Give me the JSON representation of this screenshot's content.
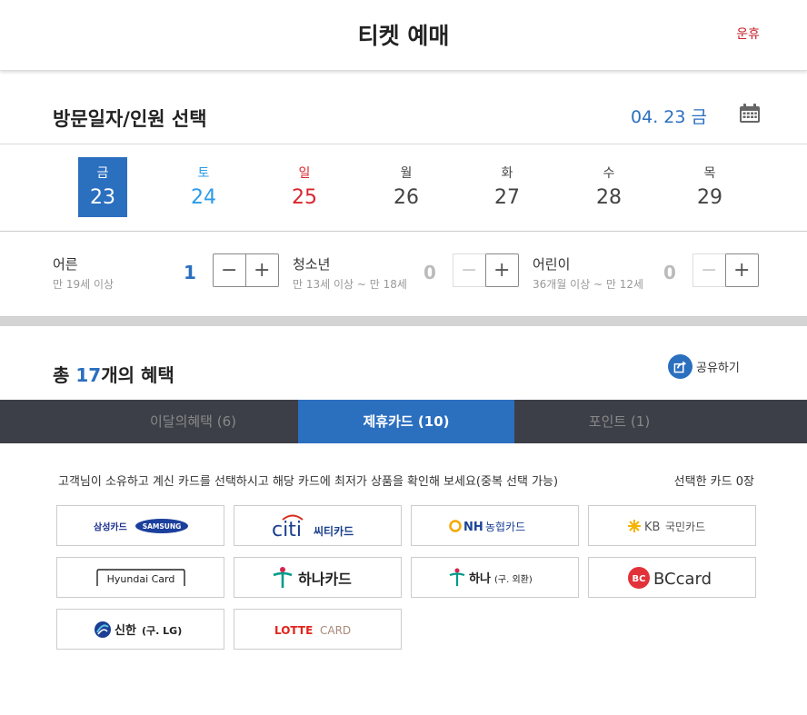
{
  "header": {
    "title": "티켓 예매",
    "closed_label": "운휴"
  },
  "date_section": {
    "label": "방문일자/인원 선택",
    "selected_date": "04. 23 금",
    "calendar_icon": "calendar-icon"
  },
  "days": [
    {
      "dow": "금",
      "num": "23",
      "state": "active"
    },
    {
      "dow": "토",
      "num": "24",
      "state": "sat"
    },
    {
      "dow": "일",
      "num": "25",
      "state": "sun"
    },
    {
      "dow": "월",
      "num": "26",
      "state": "normal"
    },
    {
      "dow": "화",
      "num": "27",
      "state": "normal"
    },
    {
      "dow": "수",
      "num": "28",
      "state": "normal"
    },
    {
      "dow": "목",
      "num": "29",
      "state": "normal"
    }
  ],
  "people": {
    "adult": {
      "name": "어른",
      "desc": "만 19세 이상",
      "count": "1"
    },
    "youth": {
      "name": "청소년",
      "desc": "만 13세 이상 ~ 만 18세",
      "count": "0"
    },
    "child": {
      "name": "어린이",
      "desc": "36개월 이상 ~ 만 12세",
      "count": "0"
    },
    "minus": "−",
    "plus": "+"
  },
  "benefits": {
    "prefix": "총 ",
    "count": "17",
    "suffix": "개의 혜택",
    "share_label": "공유하기"
  },
  "tabs": [
    {
      "label": "이달의혜택 (6)",
      "active": false
    },
    {
      "label": "제휴카드 (10)",
      "active": true
    },
    {
      "label": "포인트 (1)",
      "active": false
    }
  ],
  "cards_section": {
    "intro": "고객님이 소유하고 계신 카드를 선택하시고 해당 카드에 최저가 상품을 확인해 보세요(중복 선택 가능)",
    "selected_prefix": "선택한 카드 ",
    "selected_count": "0",
    "selected_suffix": "장"
  },
  "cards": {
    "samsung": {
      "kr": "삼성카드",
      "en": "SAMSUNG"
    },
    "citi": {
      "en": "citi",
      "kr": "씨티카드"
    },
    "nh": {
      "en": "NH",
      "kr": "농협카드"
    },
    "kb": {
      "en": "KB",
      "kr": "국민카드"
    },
    "hyundai": {
      "en": "Hyundai Card"
    },
    "hana": {
      "kr": "하나카드"
    },
    "hana_old": {
      "kr": "하나",
      "sub": "(구. 외환)"
    },
    "bc": {
      "mark": "BC",
      "text": "BCcard"
    },
    "shinhan": {
      "kr": "신한",
      "sub": "(구. LG)"
    },
    "lotte": {
      "a": "LOTTE",
      "b": "CARD"
    }
  },
  "colors": {
    "accent": "#2b6fbf",
    "sat": "#2d9be8",
    "sun": "#d9252d",
    "tabbar": "#3c3f47"
  }
}
